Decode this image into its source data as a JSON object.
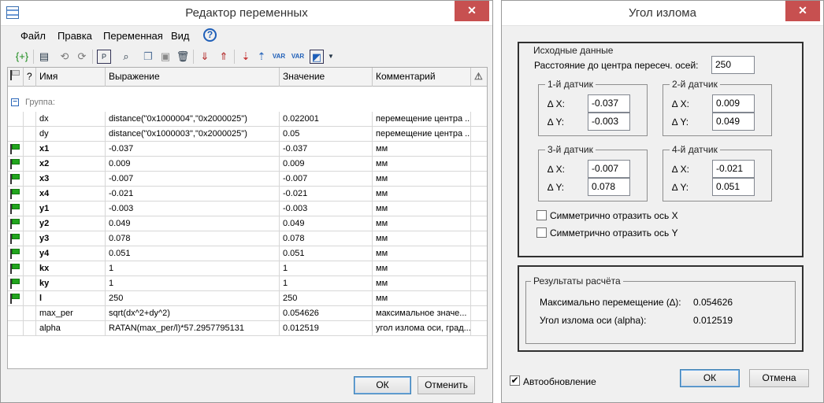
{
  "var_editor": {
    "title": "Редактор переменных",
    "close_glyph": "✕",
    "menu": [
      "Файл",
      "Правка",
      "Переменная",
      "Вид"
    ],
    "help_glyph": "?",
    "toolbar_icons": [
      "add-var-icon",
      "print-icon",
      "undo-icon",
      "redo-icon",
      "properties-icon",
      "find-icon",
      "copy-icon",
      "paste-icon",
      "delete-icon",
      "import-icon",
      "export-icon",
      "sort-asc-icon",
      "sort-desc-icon",
      "new-var-icon",
      "var-check-icon",
      "settings-icon"
    ],
    "columns": {
      "flag": "",
      "q": "?",
      "name": "Имя",
      "expr": "Выражение",
      "value": "Значение",
      "comment": "Комментарий"
    },
    "group_label": "Группа:",
    "rows": [
      {
        "name": "dx",
        "expr": "distance(\"0x1000004\",\"0x2000025\")",
        "value": "0.022001",
        "comment": "перемещение центра ...",
        "flag": false,
        "bold": false
      },
      {
        "name": "dy",
        "expr": "distance(\"0x1000003\",\"0x2000025\")",
        "value": "0.05",
        "comment": "перемещение центра ...",
        "flag": false,
        "bold": false
      },
      {
        "name": "x1",
        "expr": "-0.037",
        "value": "-0.037",
        "comment": "мм",
        "flag": true,
        "bold": true
      },
      {
        "name": "x2",
        "expr": "0.009",
        "value": "0.009",
        "comment": "мм",
        "flag": true,
        "bold": true
      },
      {
        "name": "x3",
        "expr": "-0.007",
        "value": "-0.007",
        "comment": "мм",
        "flag": true,
        "bold": true
      },
      {
        "name": "x4",
        "expr": "-0.021",
        "value": "-0.021",
        "comment": "мм",
        "flag": true,
        "bold": true
      },
      {
        "name": "y1",
        "expr": "-0.003",
        "value": "-0.003",
        "comment": "мм",
        "flag": true,
        "bold": true
      },
      {
        "name": "y2",
        "expr": "0.049",
        "value": "0.049",
        "comment": "мм",
        "flag": true,
        "bold": true
      },
      {
        "name": "y3",
        "expr": "0.078",
        "value": "0.078",
        "comment": "мм",
        "flag": true,
        "bold": true
      },
      {
        "name": "y4",
        "expr": "0.051",
        "value": "0.051",
        "comment": "мм",
        "flag": true,
        "bold": true
      },
      {
        "name": "kx",
        "expr": "1",
        "value": "1",
        "comment": "мм",
        "flag": true,
        "bold": true
      },
      {
        "name": "ky",
        "expr": "1",
        "value": "1",
        "comment": "мм",
        "flag": true,
        "bold": true
      },
      {
        "name": "l",
        "expr": "250",
        "value": "250",
        "comment": "мм",
        "flag": true,
        "bold": true
      },
      {
        "name": "max_per",
        "expr": "sqrt(dx^2+dy^2)",
        "value": "0.054626",
        "comment": "максимальное значе...",
        "flag": false,
        "bold": false
      },
      {
        "name": "alpha",
        "expr": "RATAN(max_per/l)*57.2957795131",
        "value": "0.012519",
        "comment": "угол излома оси, град...",
        "flag": false,
        "bold": false
      }
    ],
    "ok_label": "ОК",
    "cancel_label": "Отменить"
  },
  "angle_dialog": {
    "title": "Угол излома",
    "close_glyph": "✕",
    "input_group": "Исходные данные",
    "distance_label": "Расстояние до центра пересеч. осей:",
    "distance_value": "250",
    "sensors": [
      {
        "title": "1-й датчик",
        "x": "-0.037",
        "y": "-0.003"
      },
      {
        "title": "2-й датчик",
        "x": "0.009",
        "y": "0.049"
      },
      {
        "title": "3-й датчик",
        "x": "-0.007",
        "y": "0.078"
      },
      {
        "title": "4-й датчик",
        "x": "-0.021",
        "y": "0.051"
      }
    ],
    "dx_label": "∆ X:",
    "dy_label": "∆ Y:",
    "mirror_x": {
      "label": "Симметрично отразить ось X",
      "checked": false
    },
    "mirror_y": {
      "label": "Симметрично отразить ось Y",
      "checked": false
    },
    "results_group": "Результаты расчёта",
    "max_move_label": "Максимально перемещение (∆):",
    "max_move_value": "0.054626",
    "angle_label": "Угол излома оси (alpha):",
    "angle_value": "0.012519",
    "auto_update": {
      "label": "Автообновление",
      "checked": true,
      "check_glyph": "✔"
    },
    "ok_label": "ОК",
    "cancel_label": "Отмена"
  }
}
